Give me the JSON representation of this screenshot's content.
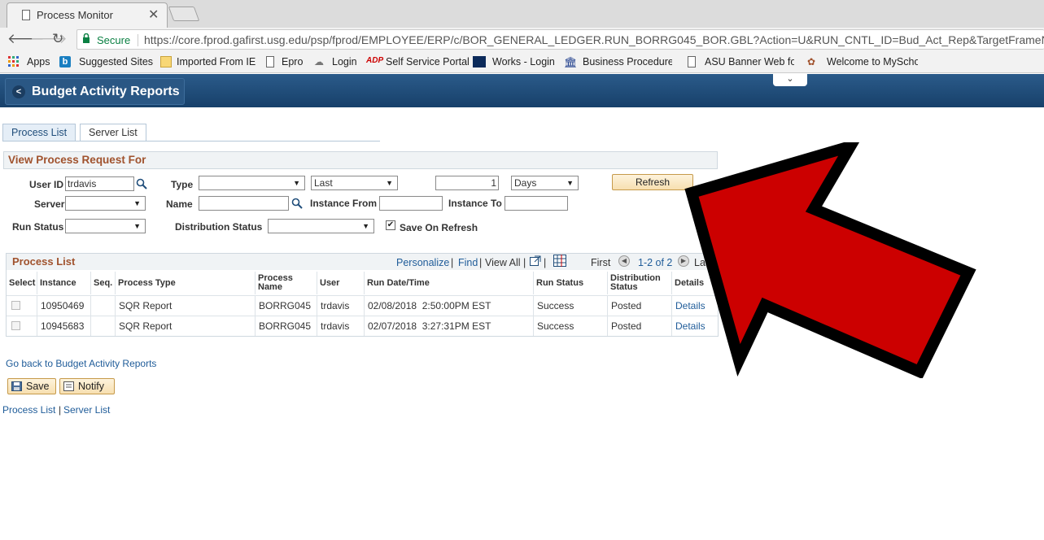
{
  "browser": {
    "tab_title": "Process Monitor",
    "tab_close": "✕",
    "secure_label": "Secure",
    "url": "https://core.fprod.gafirst.usg.edu/psp/fprod/EMPLOYEE/ERP/c/BOR_GENERAL_LEDGER.RUN_BORRG045_BOR.GBL?Action=U&RUN_CNTL_ID=Bud_Act_Rep&TargetFrameName=No",
    "bookmarks": [
      "Apps",
      "Suggested Sites",
      "Imported From IE",
      "Epro",
      "Login",
      "Self Service Portal",
      "Works - Login",
      "Business Procedures",
      "ASU Banner Web for",
      "Welcome to MySchoo"
    ]
  },
  "header": {
    "back_arrow": "<",
    "title": "Budget Activity Reports",
    "dropdown_glyph": "⌄"
  },
  "tabs": [
    {
      "label": "Process List"
    },
    {
      "label": "Server List"
    }
  ],
  "filters": {
    "group_title": "View Process Request For",
    "user_id_label": "User ID",
    "user_id_value": "trdavis",
    "type_label": "Type",
    "type_value": "",
    "last_value": "Last",
    "count_value": "1",
    "days_value": "Days",
    "refresh_label": "Refresh",
    "server_label": "Server",
    "server_value": "",
    "name_label": "Name",
    "name_value": "",
    "instance_from_label": "Instance From",
    "instance_from_value": "",
    "instance_to_label": "Instance To",
    "instance_to_value": "",
    "run_status_label": "Run Status",
    "run_status_value": "",
    "dist_status_label": "Distribution Status",
    "dist_status_value": "",
    "save_on_refresh_label": "Save On Refresh",
    "save_on_refresh_check": "✔"
  },
  "grid": {
    "title": "Process List",
    "personalize": "Personalize",
    "find": "Find",
    "view_all": "View All",
    "first": "First",
    "range": "1-2 of 2",
    "last": "Last",
    "columns": [
      "Select",
      "Instance",
      "Seq.",
      "Process Type",
      "Process Name",
      "User",
      "Run Date/Time",
      "Run Status",
      "Distribution Status",
      "Details"
    ],
    "rows": [
      {
        "instance": "10950469",
        "seq": "",
        "type": "SQR Report",
        "name": "BORRG045",
        "user": "trdavis",
        "datetime": "02/08/2018  2:50:00PM EST",
        "run_status": "Success",
        "dist_status": "Posted",
        "details": "Details"
      },
      {
        "instance": "10945683",
        "seq": "",
        "type": "SQR Report",
        "name": "BORRG045",
        "user": "trdavis",
        "datetime": "02/07/2018  3:27:31PM EST",
        "run_status": "Success",
        "dist_status": "Posted",
        "details": "Details"
      }
    ]
  },
  "footer": {
    "go_back": "Go back to Budget Activity Reports",
    "save": "Save",
    "notify": "Notify",
    "process_list": "Process List",
    "sep": "|",
    "server_list": "Server List"
  },
  "colors": {
    "arrow": "#cc0000",
    "header": "#1f4d7a",
    "group_title": "#a0522d"
  }
}
